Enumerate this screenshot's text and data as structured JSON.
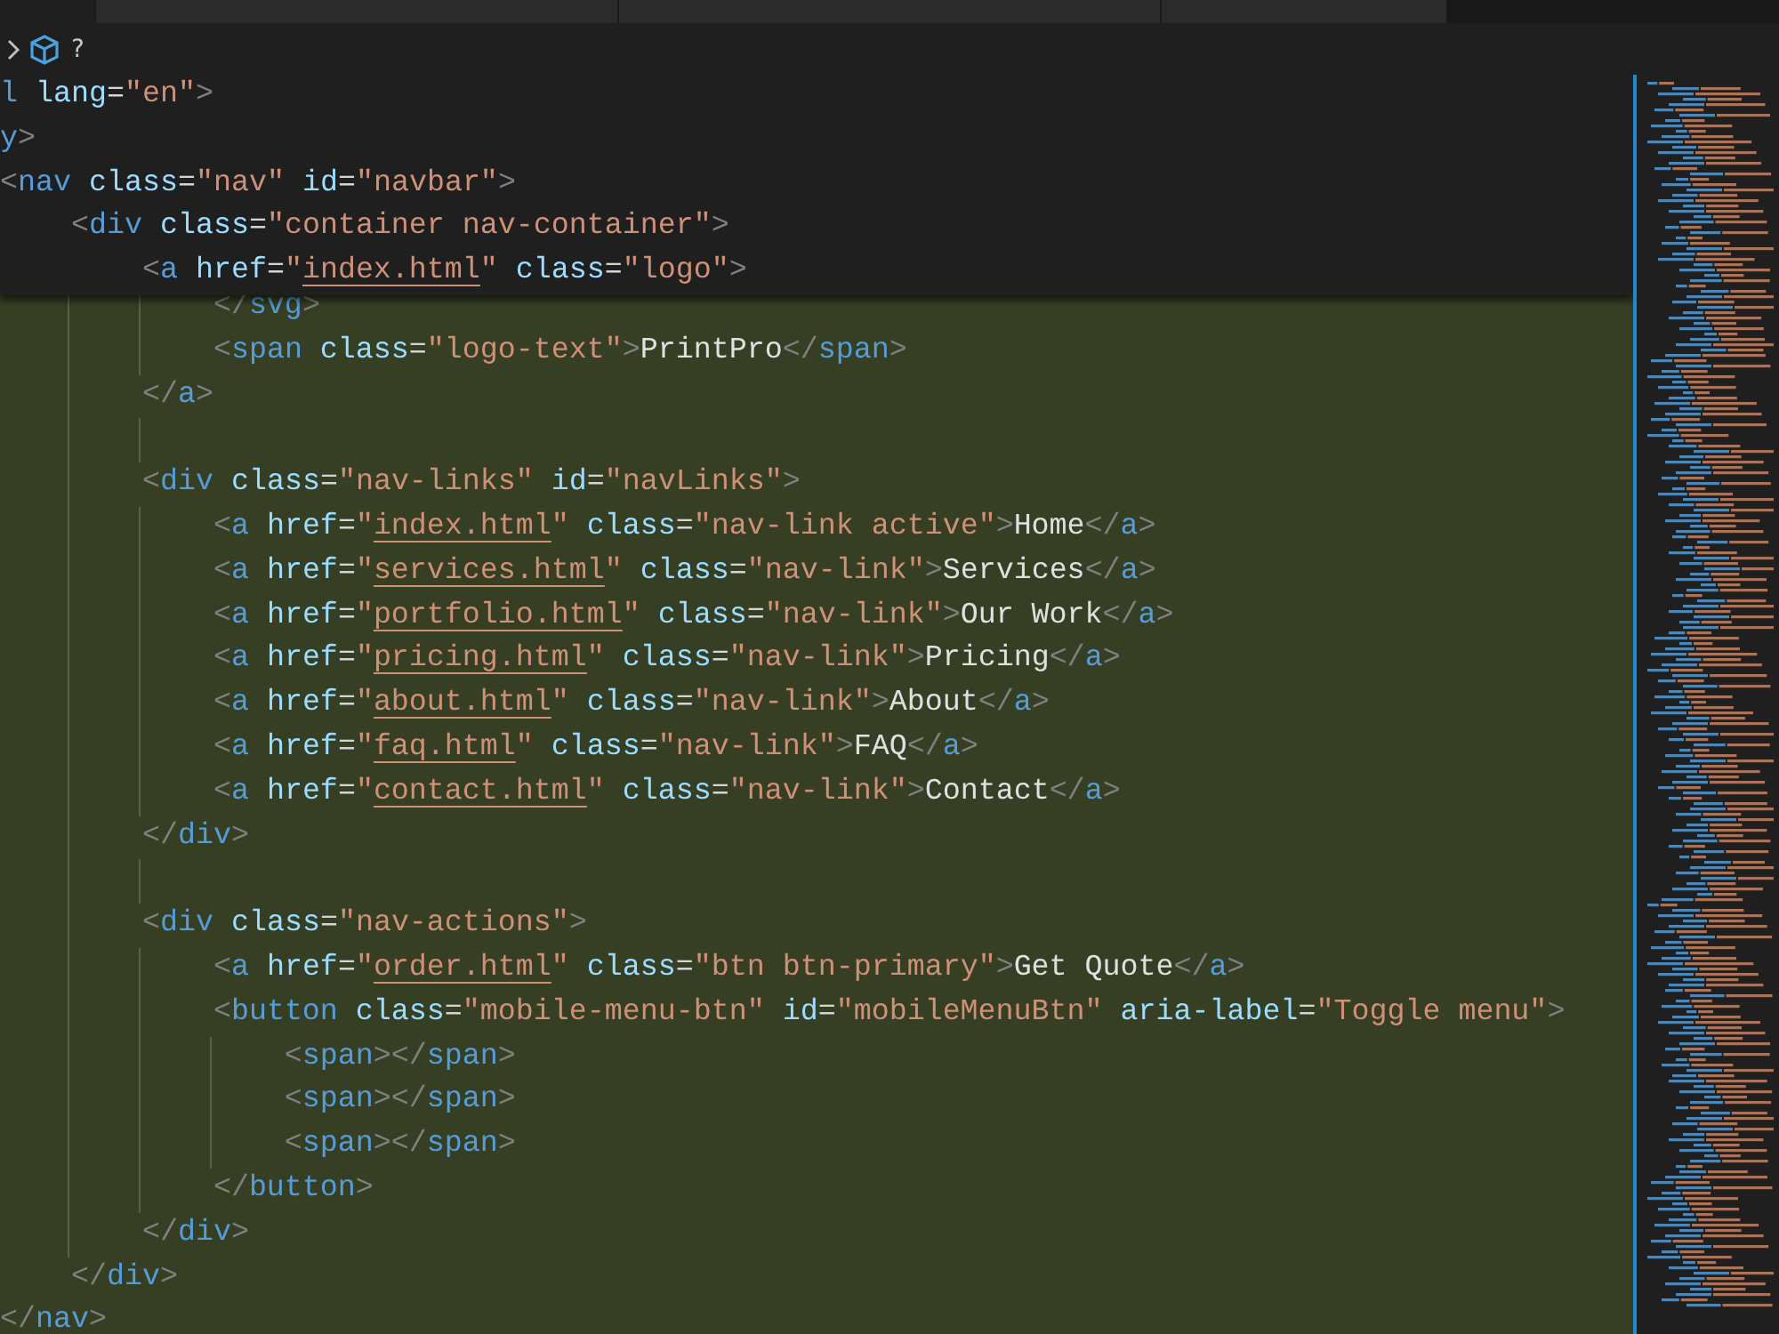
{
  "breadcrumb": {
    "unknown_symbol": "?"
  },
  "sticky_lines": [
    {
      "tokens": [
        {
          "kind": "tag",
          "text": "l"
        },
        {
          "kind": "attr",
          "text": " lang"
        },
        {
          "kind": "eq",
          "text": "="
        },
        {
          "kind": "string",
          "text": "\"en\""
        },
        {
          "kind": "bracket",
          "text": ">"
        }
      ]
    },
    {
      "tokens": [
        {
          "kind": "tag",
          "text": "y"
        },
        {
          "kind": "bracket",
          "text": ">"
        }
      ]
    },
    {
      "tokens": [
        {
          "kind": "bracket",
          "text": "<"
        },
        {
          "kind": "tag",
          "text": "nav"
        },
        {
          "kind": "attr",
          "text": " class"
        },
        {
          "kind": "eq",
          "text": "="
        },
        {
          "kind": "string",
          "text": "\"nav\""
        },
        {
          "kind": "attr",
          "text": " id"
        },
        {
          "kind": "eq",
          "text": "="
        },
        {
          "kind": "string",
          "text": "\"navbar\""
        },
        {
          "kind": "bracket",
          "text": ">"
        }
      ]
    },
    {
      "tokens": [
        {
          "kind": "bracket",
          "text": "    <"
        },
        {
          "kind": "tag",
          "text": "div"
        },
        {
          "kind": "attr",
          "text": " class"
        },
        {
          "kind": "eq",
          "text": "="
        },
        {
          "kind": "string",
          "text": "\"container nav-container\""
        },
        {
          "kind": "bracket",
          "text": ">"
        }
      ]
    },
    {
      "tokens": [
        {
          "kind": "bracket",
          "text": "        <"
        },
        {
          "kind": "tag",
          "text": "a"
        },
        {
          "kind": "attr",
          "text": " href"
        },
        {
          "kind": "eq",
          "text": "="
        },
        {
          "kind": "string",
          "text": "\""
        },
        {
          "kind": "link",
          "text": "index.html"
        },
        {
          "kind": "string",
          "text": "\""
        },
        {
          "kind": "attr",
          "text": " class"
        },
        {
          "kind": "eq",
          "text": "="
        },
        {
          "kind": "string",
          "text": "\"logo\""
        },
        {
          "kind": "bracket",
          "text": ">"
        }
      ]
    }
  ],
  "code_lines": [
    {
      "kind": "code",
      "tokens": [
        {
          "kind": "bracket",
          "text": "            </"
        },
        {
          "kind": "tag",
          "text": "svg"
        },
        {
          "kind": "bracket",
          "text": ">"
        }
      ]
    },
    {
      "kind": "code",
      "tokens": [
        {
          "kind": "bracket",
          "text": "            <"
        },
        {
          "kind": "tag",
          "text": "span"
        },
        {
          "kind": "attr",
          "text": " class"
        },
        {
          "kind": "eq",
          "text": "="
        },
        {
          "kind": "string",
          "text": "\"logo-text\""
        },
        {
          "kind": "bracket",
          "text": ">"
        },
        {
          "kind": "text",
          "text": "PrintPro"
        },
        {
          "kind": "bracket",
          "text": "</"
        },
        {
          "kind": "tag",
          "text": "span"
        },
        {
          "kind": "bracket",
          "text": ">"
        }
      ]
    },
    {
      "kind": "code",
      "tokens": [
        {
          "kind": "bracket",
          "text": "        </"
        },
        {
          "kind": "tag",
          "text": "a"
        },
        {
          "kind": "bracket",
          "text": ">"
        }
      ]
    },
    {
      "kind": "blank"
    },
    {
      "kind": "code",
      "tokens": [
        {
          "kind": "bracket",
          "text": "        <"
        },
        {
          "kind": "tag",
          "text": "div"
        },
        {
          "kind": "attr",
          "text": " class"
        },
        {
          "kind": "eq",
          "text": "="
        },
        {
          "kind": "string",
          "text": "\"nav-links\""
        },
        {
          "kind": "attr",
          "text": " id"
        },
        {
          "kind": "eq",
          "text": "="
        },
        {
          "kind": "string",
          "text": "\"navLinks\""
        },
        {
          "kind": "bracket",
          "text": ">"
        }
      ]
    },
    {
      "kind": "code",
      "tokens": [
        {
          "kind": "bracket",
          "text": "            <"
        },
        {
          "kind": "tag",
          "text": "a"
        },
        {
          "kind": "attr",
          "text": " href"
        },
        {
          "kind": "eq",
          "text": "="
        },
        {
          "kind": "string",
          "text": "\""
        },
        {
          "kind": "link",
          "text": "index.html"
        },
        {
          "kind": "string",
          "text": "\""
        },
        {
          "kind": "attr",
          "text": " class"
        },
        {
          "kind": "eq",
          "text": "="
        },
        {
          "kind": "string",
          "text": "\"nav-link active\""
        },
        {
          "kind": "bracket",
          "text": ">"
        },
        {
          "kind": "text",
          "text": "Home"
        },
        {
          "kind": "bracket",
          "text": "</"
        },
        {
          "kind": "tag",
          "text": "a"
        },
        {
          "kind": "bracket",
          "text": ">"
        }
      ]
    },
    {
      "kind": "code",
      "tokens": [
        {
          "kind": "bracket",
          "text": "            <"
        },
        {
          "kind": "tag",
          "text": "a"
        },
        {
          "kind": "attr",
          "text": " href"
        },
        {
          "kind": "eq",
          "text": "="
        },
        {
          "kind": "string",
          "text": "\""
        },
        {
          "kind": "link",
          "text": "services.html"
        },
        {
          "kind": "string",
          "text": "\""
        },
        {
          "kind": "attr",
          "text": " class"
        },
        {
          "kind": "eq",
          "text": "="
        },
        {
          "kind": "string",
          "text": "\"nav-link\""
        },
        {
          "kind": "bracket",
          "text": ">"
        },
        {
          "kind": "text",
          "text": "Services"
        },
        {
          "kind": "bracket",
          "text": "</"
        },
        {
          "kind": "tag",
          "text": "a"
        },
        {
          "kind": "bracket",
          "text": ">"
        }
      ]
    },
    {
      "kind": "code",
      "tokens": [
        {
          "kind": "bracket",
          "text": "            <"
        },
        {
          "kind": "tag",
          "text": "a"
        },
        {
          "kind": "attr",
          "text": " href"
        },
        {
          "kind": "eq",
          "text": "="
        },
        {
          "kind": "string",
          "text": "\""
        },
        {
          "kind": "link",
          "text": "portfolio.html"
        },
        {
          "kind": "string",
          "text": "\""
        },
        {
          "kind": "attr",
          "text": " class"
        },
        {
          "kind": "eq",
          "text": "="
        },
        {
          "kind": "string",
          "text": "\"nav-link\""
        },
        {
          "kind": "bracket",
          "text": ">"
        },
        {
          "kind": "text",
          "text": "Our Work"
        },
        {
          "kind": "bracket",
          "text": "</"
        },
        {
          "kind": "tag",
          "text": "a"
        },
        {
          "kind": "bracket",
          "text": ">"
        }
      ]
    },
    {
      "kind": "code",
      "tokens": [
        {
          "kind": "bracket",
          "text": "            <"
        },
        {
          "kind": "tag",
          "text": "a"
        },
        {
          "kind": "attr",
          "text": " href"
        },
        {
          "kind": "eq",
          "text": "="
        },
        {
          "kind": "string",
          "text": "\""
        },
        {
          "kind": "link",
          "text": "pricing.html"
        },
        {
          "kind": "string",
          "text": "\""
        },
        {
          "kind": "attr",
          "text": " class"
        },
        {
          "kind": "eq",
          "text": "="
        },
        {
          "kind": "string",
          "text": "\"nav-link\""
        },
        {
          "kind": "bracket",
          "text": ">"
        },
        {
          "kind": "text",
          "text": "Pricing"
        },
        {
          "kind": "bracket",
          "text": "</"
        },
        {
          "kind": "tag",
          "text": "a"
        },
        {
          "kind": "bracket",
          "text": ">"
        }
      ]
    },
    {
      "kind": "code",
      "tokens": [
        {
          "kind": "bracket",
          "text": "            <"
        },
        {
          "kind": "tag",
          "text": "a"
        },
        {
          "kind": "attr",
          "text": " href"
        },
        {
          "kind": "eq",
          "text": "="
        },
        {
          "kind": "string",
          "text": "\""
        },
        {
          "kind": "link",
          "text": "about.html"
        },
        {
          "kind": "string",
          "text": "\""
        },
        {
          "kind": "attr",
          "text": " class"
        },
        {
          "kind": "eq",
          "text": "="
        },
        {
          "kind": "string",
          "text": "\"nav-link\""
        },
        {
          "kind": "bracket",
          "text": ">"
        },
        {
          "kind": "text",
          "text": "About"
        },
        {
          "kind": "bracket",
          "text": "</"
        },
        {
          "kind": "tag",
          "text": "a"
        },
        {
          "kind": "bracket",
          "text": ">"
        }
      ]
    },
    {
      "kind": "code",
      "tokens": [
        {
          "kind": "bracket",
          "text": "            <"
        },
        {
          "kind": "tag",
          "text": "a"
        },
        {
          "kind": "attr",
          "text": " href"
        },
        {
          "kind": "eq",
          "text": "="
        },
        {
          "kind": "string",
          "text": "\""
        },
        {
          "kind": "link",
          "text": "faq.html"
        },
        {
          "kind": "string",
          "text": "\""
        },
        {
          "kind": "attr",
          "text": " class"
        },
        {
          "kind": "eq",
          "text": "="
        },
        {
          "kind": "string",
          "text": "\"nav-link\""
        },
        {
          "kind": "bracket",
          "text": ">"
        },
        {
          "kind": "text",
          "text": "FAQ"
        },
        {
          "kind": "bracket",
          "text": "</"
        },
        {
          "kind": "tag",
          "text": "a"
        },
        {
          "kind": "bracket",
          "text": ">"
        }
      ]
    },
    {
      "kind": "code",
      "tokens": [
        {
          "kind": "bracket",
          "text": "            <"
        },
        {
          "kind": "tag",
          "text": "a"
        },
        {
          "kind": "attr",
          "text": " href"
        },
        {
          "kind": "eq",
          "text": "="
        },
        {
          "kind": "string",
          "text": "\""
        },
        {
          "kind": "link",
          "text": "contact.html"
        },
        {
          "kind": "string",
          "text": "\""
        },
        {
          "kind": "attr",
          "text": " class"
        },
        {
          "kind": "eq",
          "text": "="
        },
        {
          "kind": "string",
          "text": "\"nav-link\""
        },
        {
          "kind": "bracket",
          "text": ">"
        },
        {
          "kind": "text",
          "text": "Contact"
        },
        {
          "kind": "bracket",
          "text": "</"
        },
        {
          "kind": "tag",
          "text": "a"
        },
        {
          "kind": "bracket",
          "text": ">"
        }
      ]
    },
    {
      "kind": "code",
      "tokens": [
        {
          "kind": "bracket",
          "text": "        </"
        },
        {
          "kind": "tag",
          "text": "div"
        },
        {
          "kind": "bracket",
          "text": ">"
        }
      ]
    },
    {
      "kind": "blank"
    },
    {
      "kind": "code",
      "tokens": [
        {
          "kind": "bracket",
          "text": "        <"
        },
        {
          "kind": "tag",
          "text": "div"
        },
        {
          "kind": "attr",
          "text": " class"
        },
        {
          "kind": "eq",
          "text": "="
        },
        {
          "kind": "string",
          "text": "\"nav-actions\""
        },
        {
          "kind": "bracket",
          "text": ">"
        }
      ]
    },
    {
      "kind": "code",
      "tokens": [
        {
          "kind": "bracket",
          "text": "            <"
        },
        {
          "kind": "tag",
          "text": "a"
        },
        {
          "kind": "attr",
          "text": " href"
        },
        {
          "kind": "eq",
          "text": "="
        },
        {
          "kind": "string",
          "text": "\""
        },
        {
          "kind": "link",
          "text": "order.html"
        },
        {
          "kind": "string",
          "text": "\""
        },
        {
          "kind": "attr",
          "text": " class"
        },
        {
          "kind": "eq",
          "text": "="
        },
        {
          "kind": "string",
          "text": "\"btn btn-primary\""
        },
        {
          "kind": "bracket",
          "text": ">"
        },
        {
          "kind": "text",
          "text": "Get Quote"
        },
        {
          "kind": "bracket",
          "text": "</"
        },
        {
          "kind": "tag",
          "text": "a"
        },
        {
          "kind": "bracket",
          "text": ">"
        }
      ]
    },
    {
      "kind": "code",
      "tokens": [
        {
          "kind": "bracket",
          "text": "            <"
        },
        {
          "kind": "tag",
          "text": "button"
        },
        {
          "kind": "attr",
          "text": " class"
        },
        {
          "kind": "eq",
          "text": "="
        },
        {
          "kind": "string",
          "text": "\"mobile-menu-btn\""
        },
        {
          "kind": "attr",
          "text": " id"
        },
        {
          "kind": "eq",
          "text": "="
        },
        {
          "kind": "string",
          "text": "\"mobileMenuBtn\""
        },
        {
          "kind": "attr",
          "text": " aria-label"
        },
        {
          "kind": "eq",
          "text": "="
        },
        {
          "kind": "string",
          "text": "\"Toggle menu\""
        },
        {
          "kind": "bracket",
          "text": ">"
        }
      ]
    },
    {
      "kind": "code",
      "tokens": [
        {
          "kind": "bracket",
          "text": "                <"
        },
        {
          "kind": "tag",
          "text": "span"
        },
        {
          "kind": "bracket",
          "text": "></"
        },
        {
          "kind": "tag",
          "text": "span"
        },
        {
          "kind": "bracket",
          "text": ">"
        }
      ]
    },
    {
      "kind": "code",
      "tokens": [
        {
          "kind": "bracket",
          "text": "                <"
        },
        {
          "kind": "tag",
          "text": "span"
        },
        {
          "kind": "bracket",
          "text": "></"
        },
        {
          "kind": "tag",
          "text": "span"
        },
        {
          "kind": "bracket",
          "text": ">"
        }
      ]
    },
    {
      "kind": "code",
      "tokens": [
        {
          "kind": "bracket",
          "text": "                <"
        },
        {
          "kind": "tag",
          "text": "span"
        },
        {
          "kind": "bracket",
          "text": "></"
        },
        {
          "kind": "tag",
          "text": "span"
        },
        {
          "kind": "bracket",
          "text": ">"
        }
      ]
    },
    {
      "kind": "code",
      "tokens": [
        {
          "kind": "bracket",
          "text": "            </"
        },
        {
          "kind": "tag",
          "text": "button"
        },
        {
          "kind": "bracket",
          "text": ">"
        }
      ]
    },
    {
      "kind": "code",
      "tokens": [
        {
          "kind": "bracket",
          "text": "        </"
        },
        {
          "kind": "tag",
          "text": "div"
        },
        {
          "kind": "bracket",
          "text": ">"
        }
      ]
    },
    {
      "kind": "code",
      "tokens": [
        {
          "kind": "bracket",
          "text": "    </"
        },
        {
          "kind": "tag",
          "text": "div"
        },
        {
          "kind": "bracket",
          "text": ">"
        }
      ]
    },
    {
      "kind": "code",
      "tokens": [
        {
          "kind": "bracket",
          "text": "</"
        },
        {
          "kind": "tag",
          "text": "nav"
        },
        {
          "kind": "bracket",
          "text": ">"
        }
      ]
    }
  ]
}
